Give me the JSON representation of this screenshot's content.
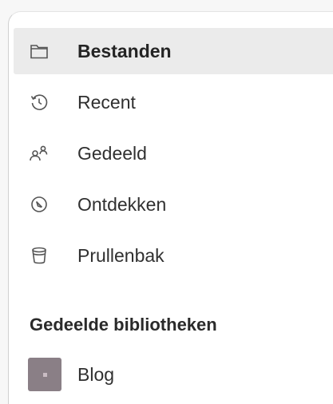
{
  "nav": {
    "items": [
      {
        "label": "Bestanden",
        "icon": "folder-icon",
        "selected": true
      },
      {
        "label": "Recent",
        "icon": "history-icon",
        "selected": false
      },
      {
        "label": "Gedeeld",
        "icon": "people-icon",
        "selected": false
      },
      {
        "label": "Ontdekken",
        "icon": "compass-icon",
        "selected": false
      },
      {
        "label": "Prullenbak",
        "icon": "trash-icon",
        "selected": false
      }
    ]
  },
  "libraries": {
    "header": "Gedeelde bibliotheken",
    "items": [
      {
        "label": "Blog",
        "thumb_color": "#8a7f86"
      }
    ]
  },
  "colors": {
    "selected_bg": "#ebebeb",
    "text": "#303030"
  }
}
